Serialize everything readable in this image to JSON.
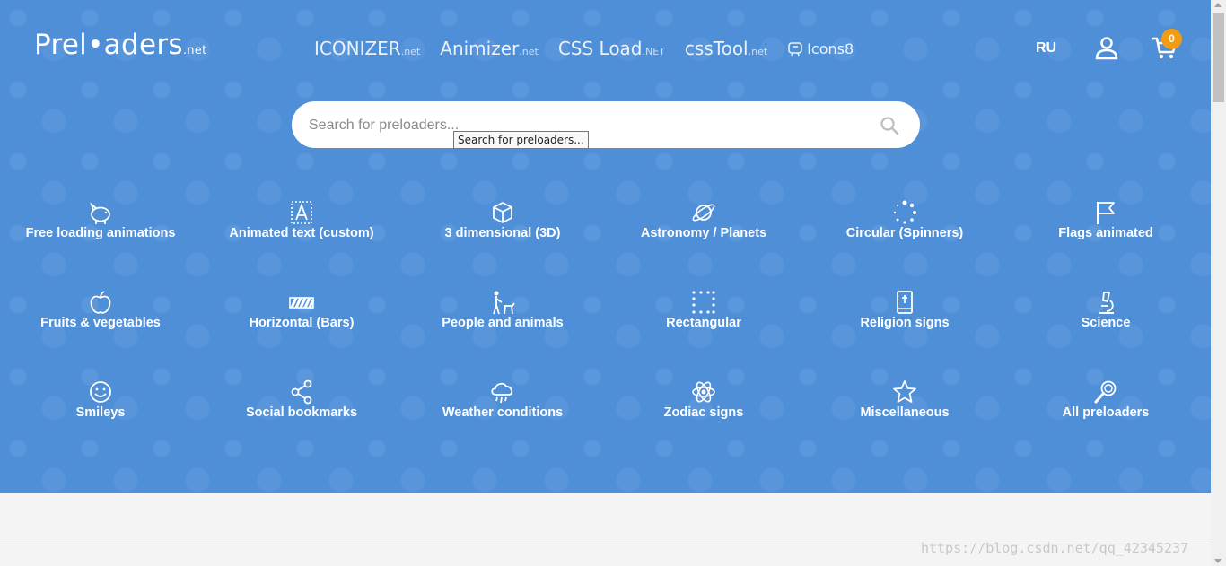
{
  "header": {
    "logo_main": "Prel•aders",
    "logo_suffix": ".net",
    "nav_links": [
      {
        "name": "ICONIZER",
        "suffix": ".net"
      },
      {
        "name": "Animizer",
        "suffix": ".net"
      },
      {
        "name": "CSS Load",
        "suffix": ".NET"
      },
      {
        "name": "cssTool",
        "suffix": ".net"
      },
      {
        "name": "Icons8",
        "suffix": ""
      }
    ],
    "lang": "RU",
    "cart_count": "0"
  },
  "search": {
    "placeholder": "Search for preloaders...",
    "tooltip": "Search for preloaders..."
  },
  "categories": [
    {
      "label": "Free loading animations",
      "icon": "piggy-bank-icon"
    },
    {
      "label": "Animated text (custom)",
      "icon": "text-frame-icon"
    },
    {
      "label": "3 dimensional (3D)",
      "icon": "cube-icon"
    },
    {
      "label": "Astronomy / Planets",
      "icon": "planet-icon"
    },
    {
      "label": "Circular (Spinners)",
      "icon": "spinner-icon"
    },
    {
      "label": "Flags animated",
      "icon": "flag-icon"
    },
    {
      "label": "Fruits & vegetables",
      "icon": "apple-icon"
    },
    {
      "label": "Horizontal (Bars)",
      "icon": "bars-icon"
    },
    {
      "label": "People and animals",
      "icon": "person-dog-icon"
    },
    {
      "label": "Rectangular",
      "icon": "dotted-square-icon"
    },
    {
      "label": "Religion signs",
      "icon": "bible-icon"
    },
    {
      "label": "Science",
      "icon": "microscope-icon"
    },
    {
      "label": "Smileys",
      "icon": "smiley-icon"
    },
    {
      "label": "Social bookmarks",
      "icon": "share-icon"
    },
    {
      "label": "Weather conditions",
      "icon": "rain-cloud-icon"
    },
    {
      "label": "Zodiac signs",
      "icon": "atom-icon"
    },
    {
      "label": "Miscellaneous",
      "icon": "star-icon"
    },
    {
      "label": "All preloaders",
      "icon": "magnifier-icon"
    }
  ],
  "watermark": "https://blog.csdn.net/qq_42345237",
  "colors": {
    "hero_bg": "#4f8fd8",
    "badge": "#f39c12",
    "text": "#ffffff"
  }
}
